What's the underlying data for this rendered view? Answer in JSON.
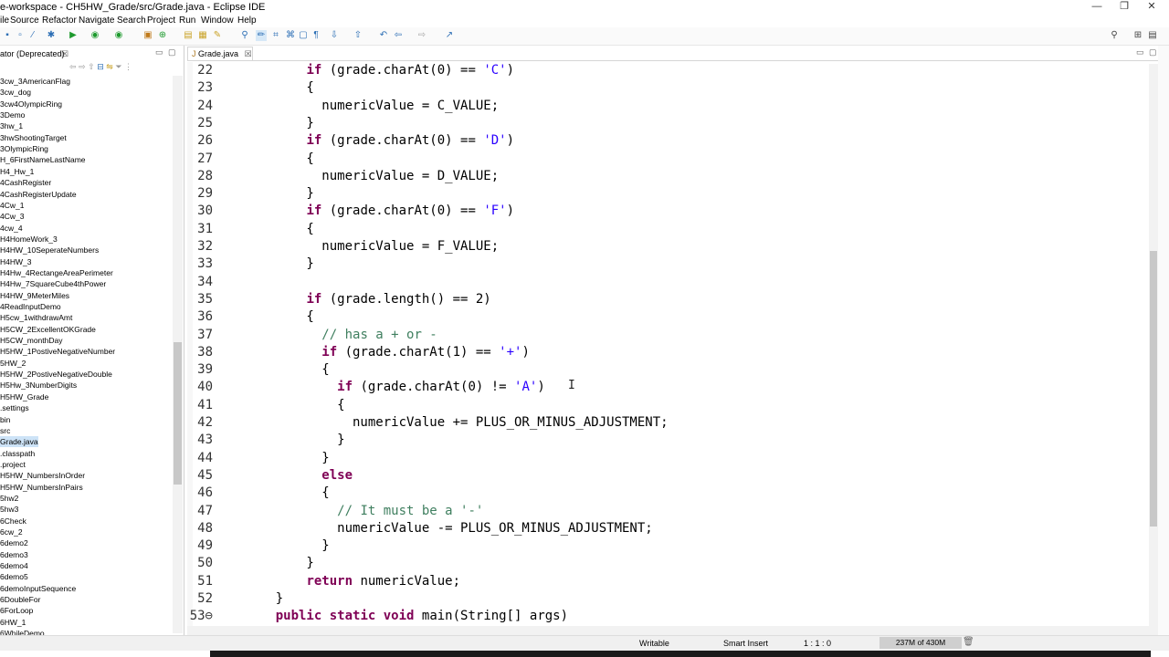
{
  "window": {
    "title": "e-workspace - CH5HW_Grade/src/Grade.java - Eclipse IDE",
    "controls": [
      "—",
      "❐",
      "✕"
    ]
  },
  "menu": [
    "ile",
    "Source",
    "Refactor",
    "Navigate",
    "Search",
    "Project",
    "Run",
    "Window",
    "Help"
  ],
  "left_panel": {
    "tab_label": "ator (Deprecated)",
    "tab_close": "☒",
    "tree": [
      "3cw_3AmericanFlag",
      "3cw_dog",
      "3cw4OlympicRing",
      "3Demo",
      "3hw_1",
      "3hwShootingTarget",
      "3OlympicRing",
      "H_6FirstNameLastName",
      "H4_Hw_1",
      "4CashRegister",
      "4CashRegisterUpdate",
      "4Cw_1",
      "4Cw_3",
      "4cw_4",
      "H4HomeWork_3",
      "H4HW_10SeperateNumbers",
      "H4HW_3",
      "H4Hw_4RectangeAreaPerimeter",
      "H4Hw_7SquareCube4thPower",
      "H4HW_9MeterMiles",
      "4ReadInputDemo",
      "H5cw_1withdrawAmt",
      "H5CW_2ExcellentOKGrade",
      "H5CW_monthDay",
      "H5HW_1PostiveNegativeNumber",
      "5HW_2",
      "H5HW_2PostiveNegativeDouble",
      "H5Hw_3NumberDigits",
      "H5HW_Grade",
      ".settings",
      "bin",
      "src",
      "Grade.java",
      ".classpath",
      ".project",
      "H5HW_NumbersInOrder",
      "H5HW_NumbersInPairs",
      "5hw2",
      "5hw3",
      "6Check",
      "6cw_2",
      "6demo2",
      "6demo3",
      "6demo4",
      "6demo5",
      "6demoInputSequence",
      "6DoubleFor",
      "6ForLoop",
      "6HW_1",
      "6WhileDemo"
    ],
    "selected_item": "Grade.java"
  },
  "editor": {
    "tab_label": "Grade.java",
    "tab_close": "☒",
    "lines": [
      {
        "n": "22",
        "code": [
          {
            "t": "        "
          },
          {
            "k": "if"
          },
          {
            "t": " (grade.charAt(0) == "
          },
          {
            "s": "'C'"
          },
          {
            "t": ")"
          }
        ]
      },
      {
        "n": "23",
        "code": [
          {
            "t": "        {"
          }
        ]
      },
      {
        "n": "24",
        "code": [
          {
            "t": "          numericValue = C_VALUE;"
          }
        ]
      },
      {
        "n": "25",
        "code": [
          {
            "t": "        }"
          }
        ]
      },
      {
        "n": "26",
        "code": [
          {
            "t": "        "
          },
          {
            "k": "if"
          },
          {
            "t": " (grade.charAt(0) == "
          },
          {
            "s": "'D'"
          },
          {
            "t": ")"
          }
        ]
      },
      {
        "n": "27",
        "code": [
          {
            "t": "        {"
          }
        ]
      },
      {
        "n": "28",
        "code": [
          {
            "t": "          numericValue = D_VALUE;"
          }
        ]
      },
      {
        "n": "29",
        "code": [
          {
            "t": "        }"
          }
        ]
      },
      {
        "n": "30",
        "code": [
          {
            "t": "        "
          },
          {
            "k": "if"
          },
          {
            "t": " (grade.charAt(0) == "
          },
          {
            "s": "'F'"
          },
          {
            "t": ")"
          }
        ]
      },
      {
        "n": "31",
        "code": [
          {
            "t": "        {"
          }
        ]
      },
      {
        "n": "32",
        "code": [
          {
            "t": "          numericValue = F_VALUE;"
          }
        ]
      },
      {
        "n": "33",
        "code": [
          {
            "t": "        }"
          }
        ]
      },
      {
        "n": "34",
        "code": []
      },
      {
        "n": "35",
        "code": [
          {
            "t": "        "
          },
          {
            "k": "if"
          },
          {
            "t": " (grade.length() == 2)"
          }
        ]
      },
      {
        "n": "36",
        "code": [
          {
            "t": "        {"
          }
        ]
      },
      {
        "n": "37",
        "code": [
          {
            "t": "          "
          },
          {
            "c": "// has a + or -"
          }
        ]
      },
      {
        "n": "38",
        "code": [
          {
            "t": "          "
          },
          {
            "k": "if"
          },
          {
            "t": " (grade.charAt(1) == "
          },
          {
            "s": "'+'"
          },
          {
            "t": ")"
          }
        ]
      },
      {
        "n": "39",
        "code": [
          {
            "t": "          {"
          }
        ]
      },
      {
        "n": "40",
        "code": [
          {
            "t": "            "
          },
          {
            "k": "if"
          },
          {
            "t": " (grade.charAt(0) != "
          },
          {
            "s": "'A'"
          },
          {
            "t": ")"
          }
        ]
      },
      {
        "n": "41",
        "code": [
          {
            "t": "            {"
          }
        ]
      },
      {
        "n": "42",
        "code": [
          {
            "t": "              numericValue += PLUS_OR_MINUS_ADJUSTMENT;"
          }
        ]
      },
      {
        "n": "43",
        "code": [
          {
            "t": "            }"
          }
        ]
      },
      {
        "n": "44",
        "code": [
          {
            "t": "          }"
          }
        ]
      },
      {
        "n": "45",
        "code": [
          {
            "t": "          "
          },
          {
            "k": "else"
          }
        ]
      },
      {
        "n": "46",
        "code": [
          {
            "t": "          {"
          }
        ]
      },
      {
        "n": "47",
        "code": [
          {
            "t": "            "
          },
          {
            "c": "// It must be a '-'"
          }
        ]
      },
      {
        "n": "48",
        "code": [
          {
            "t": "            numericValue -= PLUS_OR_MINUS_ADJUSTMENT;"
          }
        ]
      },
      {
        "n": "49",
        "code": [
          {
            "t": "          }"
          }
        ]
      },
      {
        "n": "50",
        "code": [
          {
            "t": "        }"
          }
        ]
      },
      {
        "n": "51",
        "code": [
          {
            "t": "        "
          },
          {
            "k": "return"
          },
          {
            "t": " numericValue;"
          }
        ]
      },
      {
        "n": "52",
        "code": [
          {
            "t": "    }"
          }
        ]
      },
      {
        "n": "53⊖",
        "code": [
          {
            "t": "    "
          },
          {
            "k": "public"
          },
          {
            "t": " "
          },
          {
            "k": "static"
          },
          {
            "t": " "
          },
          {
            "k": "void"
          },
          {
            "t": " main(String[] args)"
          }
        ]
      }
    ]
  },
  "status": {
    "writable": "Writable",
    "insert_mode": "Smart Insert",
    "position": "1 : 1 : 0",
    "heap": "237M of 430M"
  }
}
